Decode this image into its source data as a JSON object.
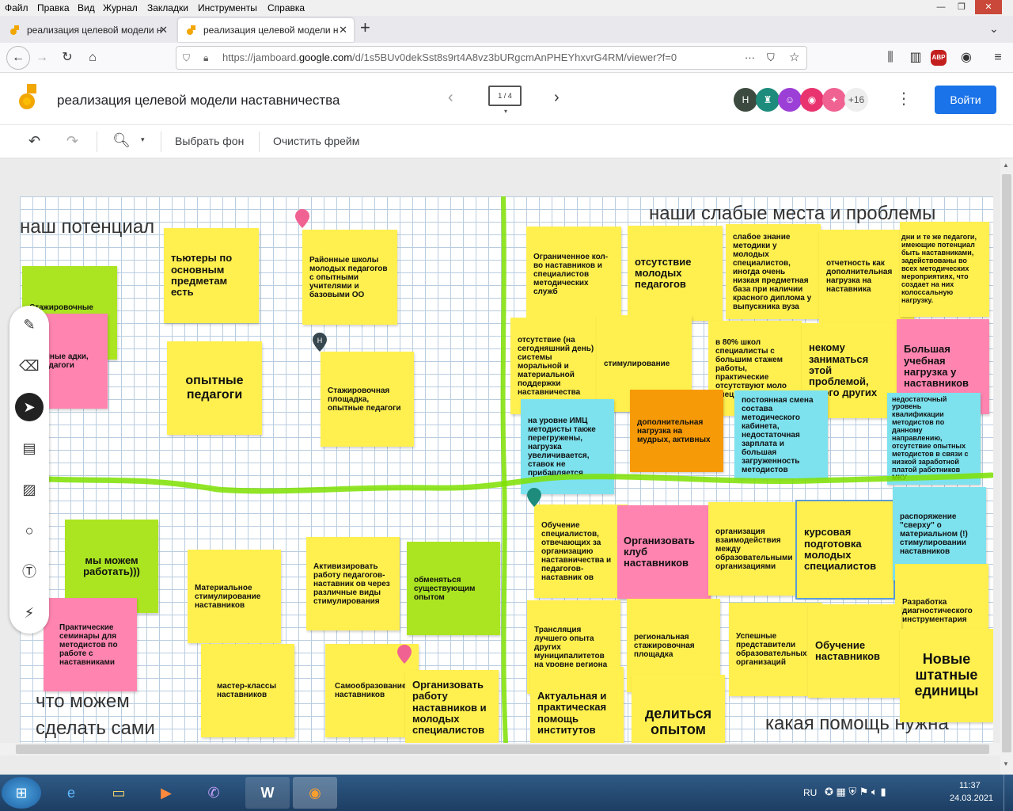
{
  "browser": {
    "menu": [
      "Файл",
      "Правка",
      "Вид",
      "Журнал",
      "Закладки",
      "Инструменты",
      "Справка"
    ],
    "tabs": [
      {
        "label": "реализация целевой модели н"
      },
      {
        "label": "реализация целевой модели н"
      }
    ],
    "new_tab": "+",
    "url_prefix": "https://jamboard.",
    "url_host": "google.com",
    "url_path": "/d/1s5BUv0dekSst8s9rt4A8vz3bURgcmAnPHEYhxvrG4RM/viewer?f=0",
    "url_more": "···",
    "abp_badge": "ABP",
    "window_controls": [
      "—",
      "❐",
      "✕"
    ]
  },
  "app": {
    "title": "реализация целевой модели наставничества",
    "frame_indicator": "1 / 4",
    "avatars": [
      {
        "label": "Н",
        "color": "#3c4a3f"
      },
      {
        "label": "♜",
        "color": "#1e8c7c"
      },
      {
        "label": "☺",
        "color": "#9c3fd6"
      },
      {
        "label": "◉",
        "color": "#e8336e"
      },
      {
        "label": "✦",
        "color": "#f06292"
      }
    ],
    "avatar_more": "+16",
    "join_button": "Войти",
    "toolbar": {
      "set_background": "Выбрать фон",
      "clear_frame": "Очистить фрейм"
    }
  },
  "board": {
    "headings": {
      "potential": "наш потенциал",
      "weak": "наши слабые места и проблемы",
      "can_do_1": "что можем",
      "can_do_2": "сделать сами",
      "help": "какая помощь нужна"
    },
    "notes": [
      {
        "text": "тьютеры по основным предметам есть"
      },
      {
        "text": "Районные школы молодых педагогов с опытными учителями и базовыми ОО"
      },
      {
        "text": "Стажировочные"
      },
      {
        "text": "ровочные адки, ые педагоги"
      },
      {
        "text": "опытные педагоги"
      },
      {
        "text": "Стажировочная площадка, опытные педагоги"
      },
      {
        "text": "Ограниченное кол-во наставников и специалистов методических служб"
      },
      {
        "text": "отсутствие молодых педагогов"
      },
      {
        "text": "слабое знание методики у молодых специалистов, иногда очень низкая предметная база при наличии красного диплома у выпускника вуза"
      },
      {
        "text": "отчетность как дополнительная нагрузка на наставника"
      },
      {
        "text": "дни и те же педагоги, имеющие потенциал быть наставниками, задействованы во всех методических мероприятиях, что создает на них колоссальную нагрузку."
      },
      {
        "text": "отсутствие (на сегодняшний день) системы моральной и материальной поддержки наставничества"
      },
      {
        "text": "стимулирование"
      },
      {
        "text": "в 80% школ специалисты с большим стажем работы, практические отсутствуют моло спец"
      },
      {
        "text": "некому заниматься этой проблемой, много других"
      },
      {
        "text": "Большая учебная нагрузка у наставников"
      },
      {
        "text": "на уровне ИМЦ методисты также перегружены, нагрузка увеличивается, ставок не прибавляется"
      },
      {
        "text": "дополнительная нагрузка на мудрых, активных"
      },
      {
        "text": "постоянная смена состава методического кабинета, недостаточная зарплата и большая загруженность методистов"
      },
      {
        "text": "недостаточный уровень квалификации методистов по данному направлению, отсутствие опытных методистов в связи с низкой заработной платой работников МКУ"
      },
      {
        "text": "мы можем работать)))"
      },
      {
        "text": "Практические семинары для методистов по работе с наставниками"
      },
      {
        "text": "Материальное стимулирование наставников"
      },
      {
        "text": "Активизировать работу педагогов-наставник ов через различные виды стимулирования"
      },
      {
        "text": "обменяться существующим опытом"
      },
      {
        "text": "мастер-классы наставников"
      },
      {
        "text": "Самообразование наставников"
      },
      {
        "text": "Организовать работу наставников и молодых специалистов"
      },
      {
        "text": "Обучение специалистов, отвечающих за организацию наставничества и педагогов-наставник ов"
      },
      {
        "text": "Организовать клуб наставников"
      },
      {
        "text": "организация взаимодействия между образовательными организациями"
      },
      {
        "text": "курсовая подготовка молодых специалистов"
      },
      {
        "text": "распоряжение \"сверху\" о материальном (!) стимулировании наставников"
      },
      {
        "text": "Разработка диагностического инструментария"
      },
      {
        "text": "Трансляция лучшего опыта других муниципалитетов на уровне региона"
      },
      {
        "text": "региональная стажировочная площадка"
      },
      {
        "text": "Успешные представители образовательных организаций"
      },
      {
        "text": "Обучение наставников"
      },
      {
        "text": "Новые штатные единицы"
      },
      {
        "text": "Актуальная и практическая помощь институтов"
      },
      {
        "text": "делиться опытом"
      }
    ],
    "pins": [
      "Н"
    ]
  },
  "taskbar": {
    "lang": "RU",
    "time": "11:37",
    "date": "24.03.2021"
  }
}
